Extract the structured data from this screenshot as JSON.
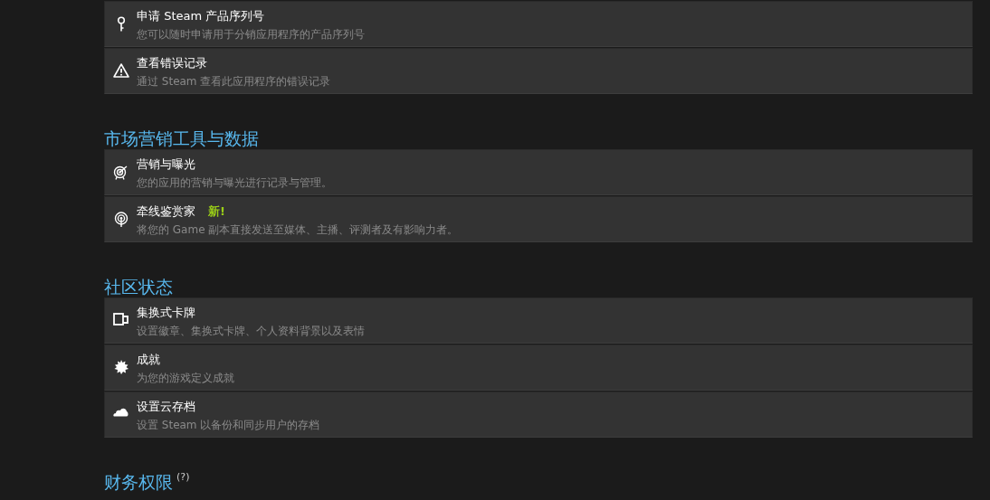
{
  "sections": [
    {
      "items": [
        {
          "kind": "key",
          "title": "申请 Steam 产品序列号",
          "description": "您可以随时申请用于分销应用程序的产品序列号"
        },
        {
          "kind": "warning",
          "title": "查看错误记录",
          "description": "通过 Steam 查看此应用程序的错误记录"
        }
      ]
    },
    {
      "heading": "市场营销工具与数据",
      "items": [
        {
          "kind": "target",
          "title": "营销与曝光",
          "description": "您的应用的营销与曝光进行记录与管理。"
        },
        {
          "kind": "broadcast",
          "title": "牵线鉴赏家",
          "badge": "新!",
          "description": "将您的 Game 副本直接发送至媒体、主播、评测者及有影响力者。"
        }
      ]
    },
    {
      "heading": "社区状态",
      "items": [
        {
          "kind": "cards",
          "title": "集换式卡牌",
          "description": "设置徽章、集换式卡牌、个人资料背景以及表情"
        },
        {
          "kind": "burst",
          "title": "成就",
          "description": "为您的游戏定义成就"
        },
        {
          "kind": "cloud",
          "title": "设置云存档",
          "description": "设置 Steam 以备份和同步用户的存档"
        }
      ]
    },
    {
      "heading": "财务权限",
      "help": "(?)"
    }
  ]
}
